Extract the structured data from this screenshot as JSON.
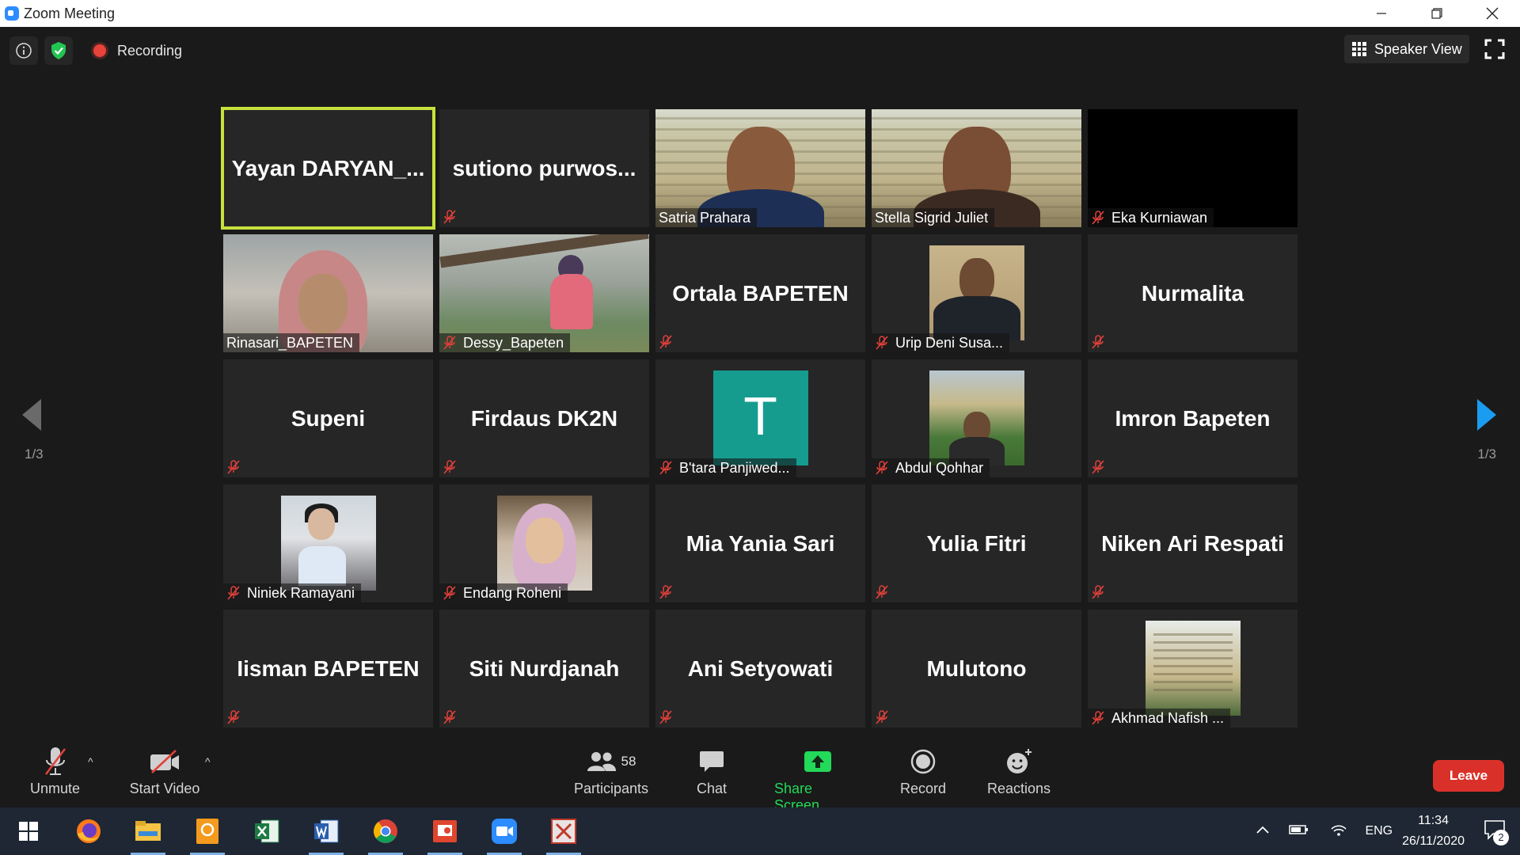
{
  "window": {
    "title": "Zoom Meeting"
  },
  "top": {
    "recording_label": "Recording",
    "speaker_view_label": "Speaker View"
  },
  "pagination": {
    "left": "1/3",
    "right": "1/3"
  },
  "tiles": [
    {
      "name": "Yayan  DARYAN_...",
      "kind": "name",
      "active": true,
      "muted": false
    },
    {
      "name": "sutiono  purwos...",
      "kind": "name",
      "muted": true
    },
    {
      "name": "Satria Prahara",
      "kind": "video-man",
      "muted": false
    },
    {
      "name": "Stella Sigrid Juliet",
      "kind": "video-woman",
      "muted": false
    },
    {
      "name": "Eka Kurniawan",
      "kind": "black",
      "muted": true
    },
    {
      "name": "Rinasari_BAPETEN",
      "kind": "video-room",
      "muted": false
    },
    {
      "name": "Dessy_Bapeten",
      "kind": "video-tree",
      "muted": true
    },
    {
      "name": "Ortala BAPETEN",
      "kind": "name",
      "muted": true
    },
    {
      "name": "Urip Deni Susa...",
      "kind": "photo-suit",
      "muted": true
    },
    {
      "name": "Nurmalita",
      "kind": "name",
      "muted": true
    },
    {
      "name": "Supeni",
      "kind": "name",
      "muted": true
    },
    {
      "name": "Firdaus DK2N",
      "kind": "name",
      "muted": true
    },
    {
      "name": "B'tara Panjiwed...",
      "kind": "avatar-T",
      "avatar_letter": "T",
      "muted": true
    },
    {
      "name": "Abdul Qohhar",
      "kind": "photo-outdoor",
      "muted": true
    },
    {
      "name": "Imron Bapeten",
      "kind": "name",
      "muted": true
    },
    {
      "name": "Niniek Ramayani",
      "kind": "photo-office",
      "muted": true
    },
    {
      "name": "Endang Roheni",
      "kind": "photo-hijab",
      "muted": true
    },
    {
      "name": "Mia Yania Sari",
      "kind": "name",
      "muted": true
    },
    {
      "name": "Yulia Fitri",
      "kind": "name",
      "muted": true
    },
    {
      "name": "Niken Ari Respati",
      "kind": "name",
      "muted": true
    },
    {
      "name": "Iisman BAPETEN",
      "kind": "name",
      "muted": true
    },
    {
      "name": "Siti Nurdjanah",
      "kind": "name",
      "muted": true
    },
    {
      "name": "Ani Setyowati",
      "kind": "name",
      "muted": true
    },
    {
      "name": "Mulutono",
      "kind": "name",
      "muted": true
    },
    {
      "name": "Akhmad Nafish ...",
      "kind": "photo-building",
      "muted": true
    }
  ],
  "toolbar": {
    "unmute": "Unmute",
    "start_video": "Start Video",
    "participants": "Participants",
    "participants_count": "58",
    "chat": "Chat",
    "share_screen": "Share Screen",
    "record": "Record",
    "reactions": "Reactions",
    "leave": "Leave"
  },
  "taskbar": {
    "apps": [
      "windows-start-icon",
      "firefox-icon",
      "file-explorer-icon",
      "pdf-tool-icon",
      "excel-icon",
      "word-icon",
      "chrome-icon",
      "presentation-icon",
      "zoom-icon",
      "pdf-reader-icon"
    ],
    "language": "ENG",
    "time": "11:34",
    "date": "26/11/2020",
    "notification_count": "2"
  },
  "colors": {
    "active_speaker_border": "#c6e23c",
    "share_green": "#23d959",
    "leave_red": "#d9312a",
    "mute_red": "#e2403a",
    "avatar_teal": "#169c8f"
  }
}
